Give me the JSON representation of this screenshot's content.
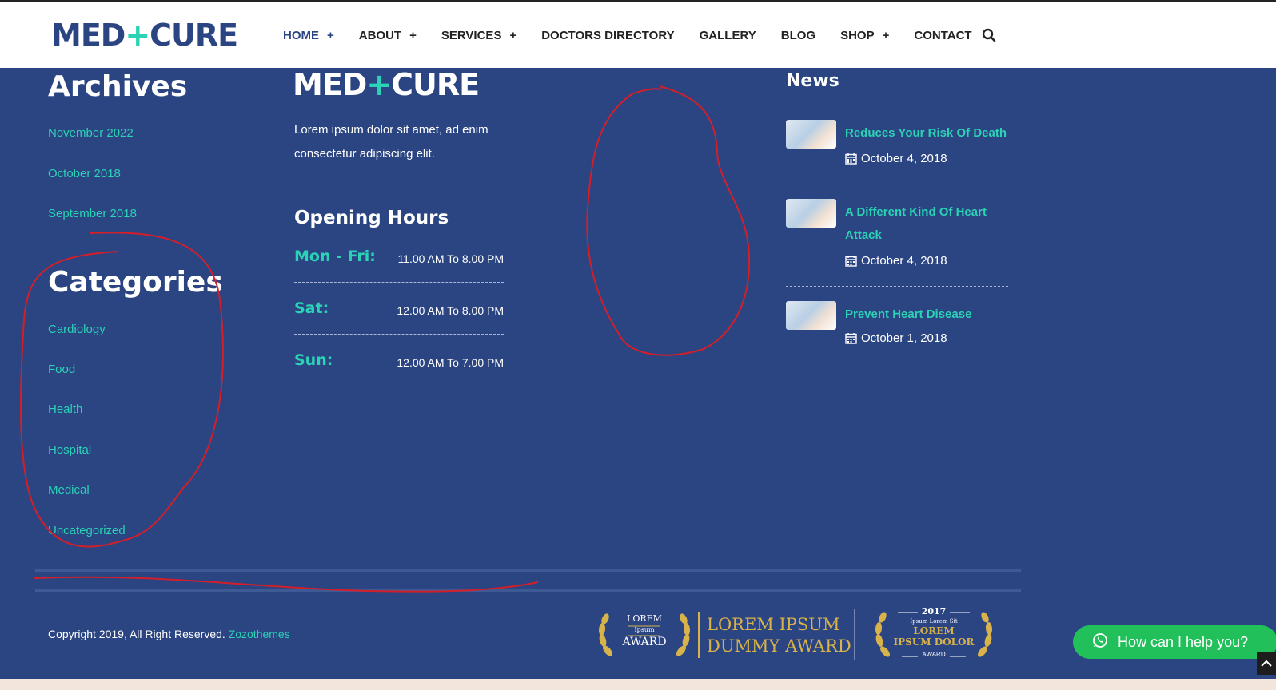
{
  "header": {
    "logo_left": "MED",
    "logo_plus": "+",
    "logo_right": "CURE",
    "nav": [
      {
        "label": "HOME",
        "caret": "+"
      },
      {
        "label": "ABOUT",
        "caret": "+"
      },
      {
        "label": "SERVICES",
        "caret": "+"
      },
      {
        "label": "DOCTORS DIRECTORY",
        "caret": ""
      },
      {
        "label": "GALLERY",
        "caret": ""
      },
      {
        "label": "BLOG",
        "caret": ""
      },
      {
        "label": "SHOP",
        "caret": "+"
      },
      {
        "label": "CONTACT",
        "caret": ""
      }
    ],
    "search_icon": "search-icon"
  },
  "archives": {
    "title": "Archives",
    "items": [
      "November 2022",
      "October 2018",
      "September 2018"
    ]
  },
  "categories": {
    "title": "Categories",
    "items": [
      "Cardiology",
      "Food",
      "Health",
      "Hospital",
      "Medical",
      "Uncategorized"
    ]
  },
  "about": {
    "logo_left": "MED",
    "logo_plus": "+",
    "logo_right": "CURE",
    "text": "Lorem ipsum dolor sit amet, ad enim consectetur adipiscing elit."
  },
  "hours": {
    "title": "Opening Hours",
    "rows": [
      {
        "day": "Mon - Fri:",
        "time": "11.00 AM To 8.00 PM"
      },
      {
        "day": "Sat:",
        "time": "12.00 AM To 8.00 PM"
      },
      {
        "day": "Sun:",
        "time": "12.00 AM To 7.00 PM"
      }
    ]
  },
  "news": {
    "title": "News",
    "items": [
      {
        "title": "Reduces Your Risk Of Death",
        "date": "October 4, 2018"
      },
      {
        "title": "A Different Kind Of Heart Attack",
        "date": "October 4, 2018"
      },
      {
        "title": "Prevent Heart Disease",
        "date": "October 1, 2018"
      }
    ]
  },
  "footer": {
    "copyright": "Copyright 2019, All Right Reserved.",
    "company": "Zozothemes",
    "award1_top": "LOREM",
    "award1_mid": "Ipsum",
    "award1_bottom": "AWARD",
    "award2_line1": "LOREM IPSUM",
    "award2_line2": "DUMMY AWARD",
    "award3_year": "2017",
    "award3_sub": "Ipsum Lorem Sit",
    "award3_line1": "LOREM",
    "award3_line2": "IPSUM DOLOR",
    "award3_line3": "AWARD"
  },
  "whatsapp": {
    "label": "How can I help you?"
  },
  "colors": {
    "navy": "#2b4482",
    "accent": "#2bd2b5",
    "whatsapp": "#22c05a",
    "gold": "#d8b24a",
    "annotation": "#d31f2a"
  }
}
